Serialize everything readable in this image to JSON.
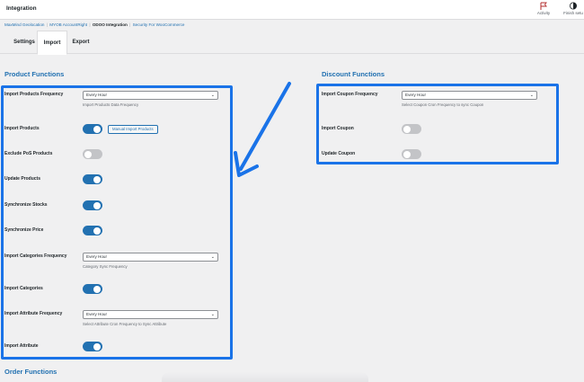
{
  "topbar": {
    "title": "Integration",
    "activity_label": "Activity",
    "finish_label": "Finish setu"
  },
  "subnav": {
    "items": [
      "MaxMind Geolocation",
      "MYOB AccountRight",
      "ODOO Integration",
      "Security For WooCommerce"
    ],
    "current_index": 2
  },
  "tabs": [
    "Settings",
    "Import",
    "Export"
  ],
  "active_tab": "Import",
  "product_functions": {
    "title": "Product Functions",
    "rows": [
      {
        "label": "Import Products Frequency",
        "type": "select",
        "value": "Every Hour",
        "desc": "Import Products Data Frequency"
      },
      {
        "label": "Import Products",
        "type": "toggle",
        "on": true,
        "button": "Manual Import Products"
      },
      {
        "label": "Exclude PoS Products",
        "type": "toggle",
        "on": false
      },
      {
        "label": "Update Products",
        "type": "toggle",
        "on": true
      },
      {
        "label": "Synchronize Stocks",
        "type": "toggle",
        "on": true
      },
      {
        "label": "Synchronize Price",
        "type": "toggle",
        "on": true
      },
      {
        "label": "Import Categories Frequency",
        "type": "select",
        "value": "Every Hour",
        "desc": "Category Sync Frequency"
      },
      {
        "label": "Import Categories",
        "type": "toggle",
        "on": true
      },
      {
        "label": "Import Attribute Frequency",
        "type": "select",
        "value": "Every Hour",
        "desc": "Select Attribute Cron Frequency to Sync Attribute"
      },
      {
        "label": "Import Attribute",
        "type": "toggle",
        "on": true
      }
    ]
  },
  "discount_functions": {
    "title": "Discount Functions",
    "rows": [
      {
        "label": "Import Coupon Frequency",
        "type": "select",
        "value": "Every Hour",
        "desc": "Select Coupon Cron Frequency to sync Coupon"
      },
      {
        "label": "Import Coupon",
        "type": "toggle",
        "on": false
      },
      {
        "label": "Update Coupon",
        "type": "toggle",
        "on": false
      }
    ]
  },
  "order_functions": {
    "title": "Order Functions"
  },
  "colors": {
    "accent": "#2271b1",
    "highlight": "#1a73e8",
    "toggle_off": "#c3c4c7"
  },
  "icons": {
    "activity": "flag-icon",
    "finish": "half-circle-icon",
    "select_chevron": "chevron-down-icon"
  }
}
